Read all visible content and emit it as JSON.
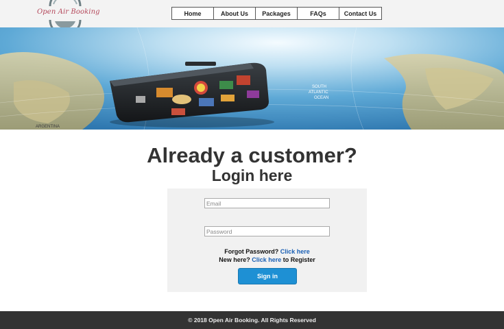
{
  "header": {
    "logo_text": "Open Air Booking",
    "nav": [
      {
        "label": "Home"
      },
      {
        "label": "About Us"
      },
      {
        "label": "Packages"
      },
      {
        "label": "FAQs"
      },
      {
        "label": "Contact Us"
      }
    ]
  },
  "banner": {
    "map_labels": [
      "ARGENTINA",
      "SOUTH",
      "ATLANTIC",
      "OCEAN"
    ]
  },
  "login": {
    "title": "Already a customer?",
    "subtitle": "Login here",
    "email_placeholder": "Email",
    "password_placeholder": "Password",
    "forgot_text": "Forgot Password?",
    "forgot_link": "Click here",
    "new_text": "New here?",
    "register_link": "Click here",
    "register_suffix": "to Register",
    "signin_label": "Sign in"
  },
  "footer": {
    "copyright": "© 2018 Open Air Booking. All Rights Reserved"
  },
  "colors": {
    "accent": "#1e90d4",
    "link": "#1a5fb4",
    "footer_bg": "#333333",
    "logo": "#b4475a"
  }
}
